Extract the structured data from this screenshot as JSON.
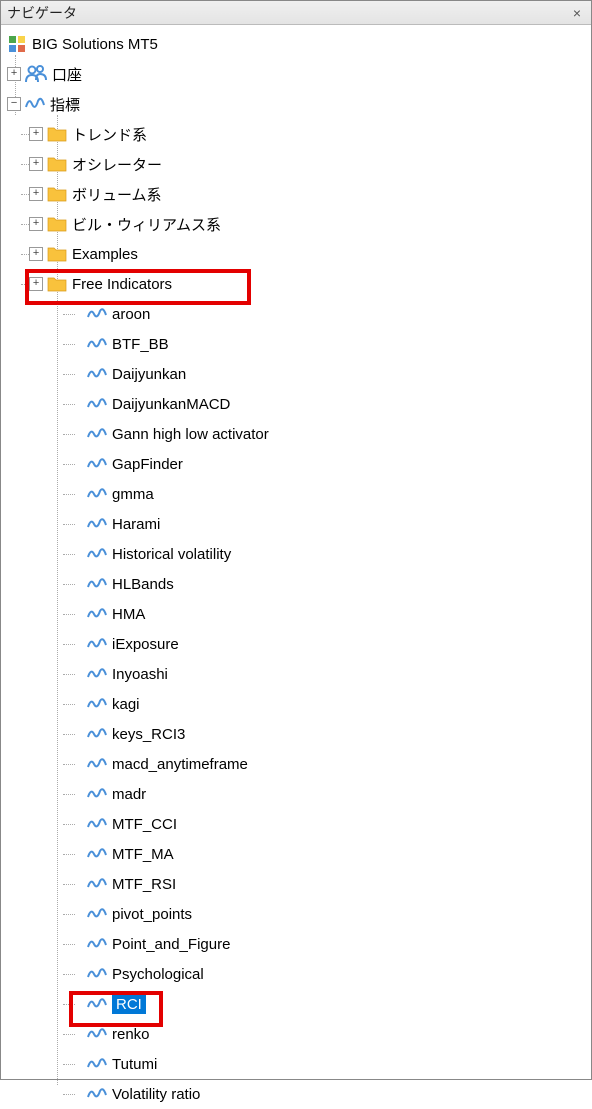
{
  "title": "ナビゲータ",
  "root": {
    "label": "BIG Solutions MT5"
  },
  "accounts": {
    "label": "口座"
  },
  "indicators": {
    "label": "指標",
    "folders": [
      {
        "label": "トレンド系"
      },
      {
        "label": "オシレーター"
      },
      {
        "label": "ボリューム系"
      },
      {
        "label": "ビル・ウィリアムス系"
      },
      {
        "label": "Examples"
      },
      {
        "label": "Free Indicators"
      }
    ],
    "items": [
      {
        "label": "aroon"
      },
      {
        "label": "BTF_BB"
      },
      {
        "label": "Daijyunkan"
      },
      {
        "label": "DaijyunkanMACD"
      },
      {
        "label": "Gann high low activator"
      },
      {
        "label": "GapFinder"
      },
      {
        "label": "gmma"
      },
      {
        "label": "Harami"
      },
      {
        "label": "Historical volatility"
      },
      {
        "label": "HLBands"
      },
      {
        "label": "HMA"
      },
      {
        "label": "iExposure"
      },
      {
        "label": "Inyoashi"
      },
      {
        "label": "kagi"
      },
      {
        "label": "keys_RCI3"
      },
      {
        "label": "macd_anytimeframe"
      },
      {
        "label": "madr"
      },
      {
        "label": "MTF_CCI"
      },
      {
        "label": "MTF_MA"
      },
      {
        "label": "MTF_RSI"
      },
      {
        "label": "pivot_points"
      },
      {
        "label": "Point_and_Figure"
      },
      {
        "label": "Psychological"
      },
      {
        "label": "RCI",
        "selected": true
      },
      {
        "label": "renko"
      },
      {
        "label": "Tutumi"
      },
      {
        "label": "Volatility ratio"
      }
    ]
  }
}
